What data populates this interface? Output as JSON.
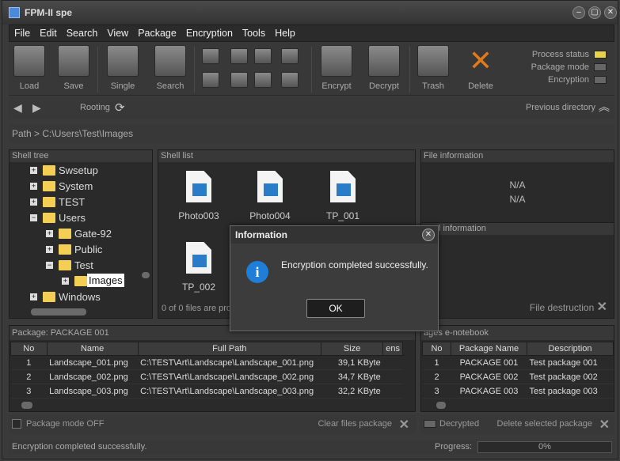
{
  "window": {
    "title": "FPM-II spe"
  },
  "menu": [
    "File",
    "Edit",
    "Search",
    "View",
    "Package",
    "Encryption",
    "Tools",
    "Help"
  ],
  "toolbar": {
    "load": "Load",
    "save": "Save",
    "single": "Single",
    "search": "Search",
    "encrypt": "Encrypt",
    "decrypt": "Decrypt",
    "trash": "Trash",
    "delete": "Delete"
  },
  "status_indicators": {
    "process": "Process status",
    "package_mode": "Package mode",
    "encryption": "Encryption",
    "process_color": "#e8d24a"
  },
  "nav": {
    "rooting": "Rooting",
    "previous": "Previous directory"
  },
  "path": {
    "label": "Path >",
    "value": "C:\\Users\\Test\\Images"
  },
  "shell_tree": {
    "title": "Shell tree",
    "items": [
      "Swsetup",
      "System",
      "TEST",
      "Users",
      "Gate-92",
      "Public",
      "Test",
      "Images",
      "Windows"
    ]
  },
  "shell_list": {
    "title": "Shell list",
    "files": [
      "Photo003",
      "Photo004",
      "TP_001",
      "TP_002"
    ],
    "footer": "0 of 0 files are pro"
  },
  "file_info": {
    "title": "File information",
    "line1": "N/A",
    "line2": "N/A"
  },
  "control_info": {
    "title": "ntrol information",
    "destruction": "File destruction"
  },
  "package": {
    "title": "Package: PACKAGE 001",
    "columns": [
      "No",
      "Name",
      "Full Path",
      "Size",
      "ens"
    ],
    "rows": [
      [
        "1",
        "Landscape_001.png",
        "C:\\TEST\\Art\\Landscape\\Landscape_001.png",
        "39,1 KByte"
      ],
      [
        "2",
        "Landscape_002.png",
        "C:\\TEST\\Art\\Landscape\\Landscape_002.png",
        "34,7 KByte"
      ],
      [
        "3",
        "Landscape_003.png",
        "C:\\TEST\\Art\\Landscape\\Landscape_003.png",
        "32,2 KByte"
      ]
    ],
    "mode": "Package mode OFF",
    "clear": "Clear files package"
  },
  "notebook": {
    "title": "ages e-notebook",
    "columns": [
      "No",
      "Package Name",
      "Description"
    ],
    "rows": [
      [
        "1",
        "PACKAGE 001",
        "Test package 001"
      ],
      [
        "2",
        "PACKAGE 002",
        "Test package 002"
      ],
      [
        "3",
        "PACKAGE 003",
        "Test package 003"
      ]
    ],
    "decrypted": "Decrypted",
    "delete": "Delete selected  package"
  },
  "dialog": {
    "title": "Information",
    "message": "Encryption completed successfully.",
    "ok": "OK"
  },
  "statusbar": {
    "message": "Encryption completed successfully.",
    "progress_label": "Progress:",
    "progress": "0%"
  }
}
